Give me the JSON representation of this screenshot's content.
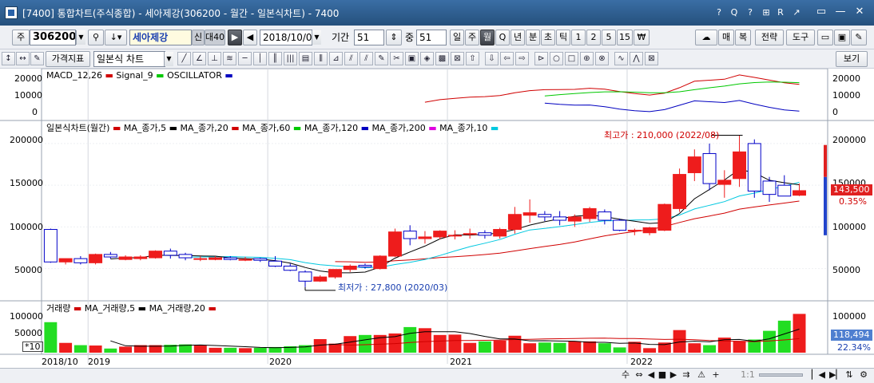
{
  "window": {
    "title": "[7400] 통합차트(주식종합) - 세아제강(306200 - 월간 - 일본식차트) - 7400",
    "title_icons": [
      "?",
      "Q",
      "?",
      "⊞",
      "R",
      "↗"
    ],
    "controls": [
      "▭",
      "—",
      "▢",
      "✕"
    ]
  },
  "toolbar1": {
    "market": "주",
    "code": "306200",
    "name": "세아제강",
    "credit_label": "신",
    "margin_label": "대40",
    "date": "2018/10/05",
    "period_label": "기간",
    "period_value": "51",
    "mid_label": "중",
    "mid_value": "51",
    "intervals": [
      "일",
      "주",
      "월",
      "Q",
      "년",
      "분",
      "초",
      "틱",
      "1",
      "2",
      "5",
      "15",
      "₩"
    ],
    "active_interval": "월",
    "right_buttons": [
      "매",
      "복",
      "전략",
      "도구"
    ]
  },
  "toolbar2": {
    "left_buttons": [
      "↕",
      "↔"
    ],
    "indicator_button": "가격지표",
    "chart_type": "일본식 차트",
    "tool_glyphs": [
      "╱",
      "∠",
      "⊥",
      "≋",
      "─",
      "│",
      "║",
      "|||",
      "▤",
      "⫼",
      "⊿",
      "⫽",
      "⫽",
      "✎",
      "✂",
      "▣",
      "◈",
      "▩",
      "⊠",
      "⇧",
      "⇩",
      "⇦",
      "⇨",
      "⊳",
      "○",
      "□",
      "⊕",
      "⊗",
      "∿",
      "⋀",
      "⊠"
    ],
    "view_button": "보기"
  },
  "panels": {
    "macd": {
      "legend": [
        {
          "text": "MACD_12,26",
          "color": "#d00000"
        },
        {
          "text": "Signal_9",
          "color": "#00c800"
        },
        {
          "text": "OSCILLATOR",
          "color": "#0000c0"
        }
      ],
      "y_ticks": [
        "20000",
        "10000",
        "0"
      ]
    },
    "price": {
      "legend": [
        {
          "text": "일본식차트(월간)",
          "color": "#d00000"
        },
        {
          "text": "MA_종가,5",
          "color": "#000000"
        },
        {
          "text": "MA_종가,20",
          "color": "#d00000"
        },
        {
          "text": "MA_종가,60",
          "color": "#00c800"
        },
        {
          "text": "MA_종가,120",
          "color": "#0000c0"
        },
        {
          "text": "MA_종가,200",
          "color": "#e000e0"
        },
        {
          "text": "MA_종가,10",
          "color": "#00c8e0"
        }
      ],
      "y_ticks": [
        "200000",
        "150000",
        "100000",
        "50000"
      ],
      "high_annotation": "최고가 : 210,000 (2022/08)",
      "low_annotation": "최저가 : 27,800 (2020/03)",
      "current_price": "143,500",
      "change_pct": "0.35%"
    },
    "volume": {
      "legend": [
        {
          "text": "거래량",
          "color": "#d00000"
        },
        {
          "text": "MA_거래량,5",
          "color": "#000000"
        },
        {
          "text": "MA_거래량,20",
          "color": "#d00000"
        }
      ],
      "y_ticks": [
        "100000",
        "50000"
      ],
      "scale_label": "*10",
      "current_volume": "118,494",
      "volume_pct": "22.34%"
    }
  },
  "date_labels": [
    "2018/10",
    "2019",
    "2020",
    "2021",
    "2022"
  ],
  "bottom_controls": [
    "수",
    "⇔",
    "◀",
    "■",
    "▶",
    "⇉",
    "⚠",
    "+",
    "1:1",
    "▏◀",
    "▶▏",
    "⇅",
    "⚙"
  ],
  "colors": {
    "up": "#ee1c1c",
    "down_fill": "#ffffff",
    "down_line": "#0000c8",
    "vol_up": "#ee1c1c",
    "vol_down": "#22dd22",
    "price_tag": "#e02020",
    "volume_tag": "#4f7fd0"
  },
  "chart_data": {
    "type": "candlestick",
    "interval": "monthly",
    "x": [
      "2018/10",
      "2018/11",
      "2018/12",
      "2019/01",
      "2019/02",
      "2019/03",
      "2019/04",
      "2019/05",
      "2019/06",
      "2019/07",
      "2019/08",
      "2019/09",
      "2019/10",
      "2019/11",
      "2019/12",
      "2020/01",
      "2020/02",
      "2020/03",
      "2020/04",
      "2020/05",
      "2020/06",
      "2020/07",
      "2020/08",
      "2020/09",
      "2020/10",
      "2020/11",
      "2020/12",
      "2021/01",
      "2021/02",
      "2021/03",
      "2021/04",
      "2021/05",
      "2021/06",
      "2021/07",
      "2021/08",
      "2021/09",
      "2021/10",
      "2021/11",
      "2021/12",
      "2022/01",
      "2022/02",
      "2022/03",
      "2022/04",
      "2022/05",
      "2022/06",
      "2022/07",
      "2022/08",
      "2022/09",
      "2022/10",
      "2022/11",
      "2022/12"
    ],
    "series": [
      {
        "name": "일본식차트(월간)",
        "ohlc": [
          [
            97000,
            98000,
            57000,
            58000
          ],
          [
            58000,
            62000,
            55000,
            62000
          ],
          [
            62000,
            65000,
            55000,
            57000
          ],
          [
            57000,
            68000,
            55000,
            67000
          ],
          [
            67000,
            70000,
            62000,
            64000
          ],
          [
            61000,
            66000,
            60000,
            64000
          ],
          [
            62000,
            66000,
            60000,
            64000
          ],
          [
            63000,
            72000,
            62000,
            71000
          ],
          [
            71000,
            74000,
            62000,
            66000
          ],
          [
            67000,
            69000,
            60000,
            63000
          ],
          [
            62000,
            65000,
            59000,
            62000
          ],
          [
            61000,
            65000,
            60000,
            63000
          ],
          [
            63000,
            65000,
            60000,
            61000
          ],
          [
            61000,
            64000,
            59000,
            61000
          ],
          [
            62000,
            63000,
            58000,
            60000
          ],
          [
            59000,
            65000,
            52000,
            53000
          ],
          [
            53000,
            56000,
            47000,
            48000
          ],
          [
            46000,
            48000,
            27800,
            35000
          ],
          [
            35000,
            42000,
            34000,
            40000
          ],
          [
            40000,
            49000,
            38000,
            49000
          ],
          [
            49000,
            55000,
            46000,
            53000
          ],
          [
            54000,
            56000,
            50000,
            52000
          ],
          [
            50000,
            66000,
            49000,
            65000
          ],
          [
            65000,
            98000,
            64000,
            94000
          ],
          [
            95000,
            102000,
            78000,
            86000
          ],
          [
            86000,
            95000,
            80000,
            88000
          ],
          [
            88000,
            96000,
            85000,
            95000
          ],
          [
            90000,
            96000,
            85000,
            90000
          ],
          [
            91000,
            98000,
            86000,
            92000
          ],
          [
            93000,
            96000,
            86000,
            90000
          ],
          [
            89000,
            99000,
            86000,
            97000
          ],
          [
            97000,
            124000,
            92000,
            115000
          ],
          [
            114000,
            133000,
            105000,
            117000
          ],
          [
            115000,
            119000,
            107000,
            112000
          ],
          [
            112000,
            119000,
            102000,
            108000
          ],
          [
            107000,
            115000,
            100000,
            112000
          ],
          [
            110000,
            124000,
            106000,
            122000
          ],
          [
            118000,
            121000,
            103000,
            108000
          ],
          [
            108000,
            110000,
            95000,
            96000
          ],
          [
            96000,
            98000,
            90000,
            96000
          ],
          [
            93000,
            100000,
            90000,
            99000
          ],
          [
            96000,
            128000,
            95000,
            127000
          ],
          [
            122000,
            170000,
            118000,
            163000
          ],
          [
            165000,
            193000,
            155000,
            184000
          ],
          [
            188000,
            200000,
            144000,
            152000
          ],
          [
            151000,
            168000,
            135000,
            156000
          ],
          [
            158000,
            210000,
            148000,
            190000
          ],
          [
            200000,
            205000,
            135000,
            143000
          ],
          [
            155000,
            160000,
            130000,
            139000
          ],
          [
            150000,
            162000,
            140000,
            137000
          ],
          [
            138000,
            152000,
            137000,
            143500
          ]
        ]
      },
      {
        "name": "거래량",
        "values": [
          81000,
          26000,
          20000,
          19000,
          11000,
          16000,
          20000,
          20000,
          21000,
          22000,
          19000,
          13000,
          13000,
          12000,
          13000,
          15000,
          17000,
          20000,
          36000,
          24000,
          44000,
          47000,
          47000,
          51000,
          68000,
          65000,
          47000,
          48000,
          26000,
          30000,
          32000,
          45000,
          25000,
          27000,
          26000,
          30000,
          30000,
          25000,
          14000,
          29000,
          12000,
          27000,
          60000,
          25000,
          20000,
          40000,
          31000,
          35000,
          58000,
          85000,
          103000,
          118000,
          121000,
          52000,
          39000,
          60000,
          33000,
          15000
        ]
      }
    ],
    "ylim": [
      20000,
      220000
    ]
  }
}
